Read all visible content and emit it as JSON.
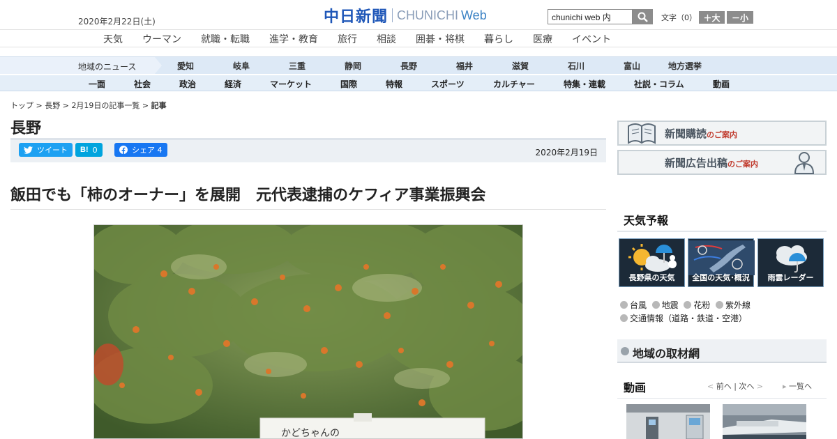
{
  "header": {
    "date": "2020年2月22日(土)",
    "logo_kanji": "中日新聞",
    "logo_en": "CHUNICHI",
    "logo_web": "Web",
    "search_value": "chunichi web 内",
    "fontsize_label": "文字（0）",
    "fontsize_up": "＋大",
    "fontsize_down": "－小"
  },
  "nav_main": [
    "天気",
    "ウーマン",
    "就職・転職",
    "進学・教育",
    "旅行",
    "相談",
    "囲碁・将棋",
    "暮らし",
    "医療",
    "イベント"
  ],
  "nav_region": {
    "label": "地域のニュース",
    "items": [
      "愛知",
      "岐阜",
      "三重",
      "静岡",
      "長野",
      "福井",
      "滋賀",
      "石川",
      "富山",
      "地方選挙"
    ]
  },
  "nav_category": [
    "一面",
    "社会",
    "政治",
    "経済",
    "マーケット",
    "国際",
    "特報",
    "スポーツ",
    "カルチャー",
    "特集・連載",
    "社説・コラム",
    "動画"
  ],
  "breadcrumb": {
    "top": "トップ",
    "sep": " > ",
    "region": "長野",
    "list": "2月19日の記事一覧",
    "current": "記事"
  },
  "section_title": "長野",
  "share": {
    "tweet": "ツイート",
    "hatena_icon": "B!",
    "hatena_count": "0",
    "facebook": "シェア",
    "facebook_count": "4",
    "date": "2020年2月19日"
  },
  "headline": "飯田でも「柿のオーナー」を展開　元代表逮捕のケフィア事業振興会",
  "photo": {
    "sign_text": "かどちゃんの"
  },
  "sidebar": {
    "banner_subscribe": "新聞購読",
    "banner_subscribe_suffix": "のご案内",
    "banner_ad": "新聞広告出稿",
    "banner_ad_suffix": "のご案内",
    "weather_title": "天気予報",
    "weather_tiles": [
      "長野県の天気",
      "全国の天気･概況",
      "雨雲レーダー"
    ],
    "weather_links": [
      "台風",
      "地震",
      "花粉",
      "紫外線"
    ],
    "traffic_link": "交通情報（道路・鉄道・空港）",
    "region_link": "地域の取材網",
    "video_title": "動画",
    "video_prev": "前へ",
    "video_next": "次へ",
    "video_list": "一覧へ"
  },
  "colors": {
    "brand": "#1f57b8",
    "twitter": "#1da1f2",
    "hatena": "#00a4de",
    "facebook": "#1877f2",
    "nav_bg": "#dde9f6"
  }
}
